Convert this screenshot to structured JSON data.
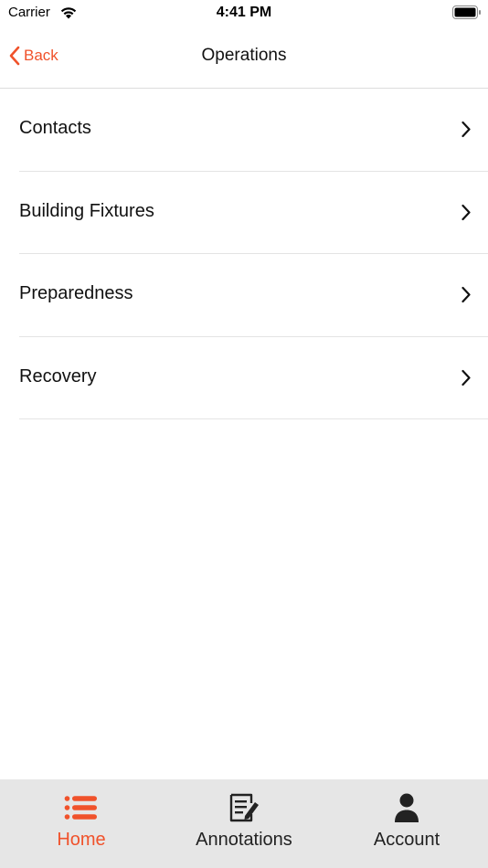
{
  "status_bar": {
    "carrier": "Carrier",
    "time": "4:41 PM"
  },
  "nav": {
    "back_label": "Back",
    "title": "Operations"
  },
  "menu": {
    "items": [
      {
        "label": "Contacts"
      },
      {
        "label": "Building Fixtures"
      },
      {
        "label": "Preparedness"
      },
      {
        "label": "Recovery"
      }
    ]
  },
  "tabs": {
    "items": [
      {
        "label": "Home",
        "icon": "list-icon",
        "active": true
      },
      {
        "label": "Annotations",
        "icon": "edit-note-icon",
        "active": false
      },
      {
        "label": "Account",
        "icon": "user-icon",
        "active": false
      }
    ]
  },
  "colors": {
    "accent": "#f0522b",
    "text": "#111111",
    "tab_bar_bg": "#e6e6e6",
    "divider": "#e4e4e4"
  }
}
